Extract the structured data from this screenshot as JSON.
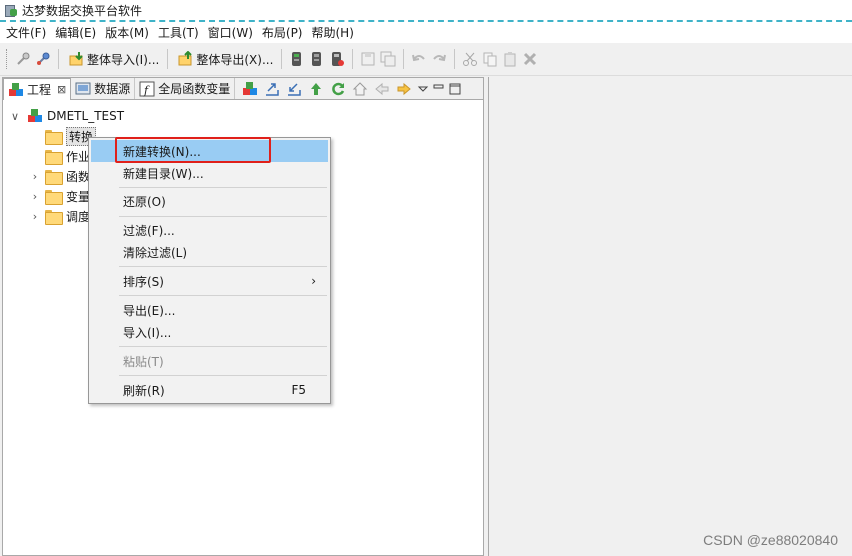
{
  "window": {
    "title": "达梦数据交换平台软件"
  },
  "menubar": {
    "items": [
      "文件(F)",
      "编辑(E)",
      "版本(M)",
      "工具(T)",
      "窗口(W)",
      "布局(P)",
      "帮助(H)"
    ]
  },
  "toolbar": {
    "import_label": "整体导入(I)...",
    "export_label": "整体导出(X)..."
  },
  "tabs": {
    "project": "工程",
    "datasource": "数据源",
    "global_vars": "全局函数变量"
  },
  "tree": {
    "root": "DMETL_TEST",
    "children": [
      "转换",
      "作业",
      "函数",
      "变量",
      "调度"
    ]
  },
  "context_menu": {
    "items": [
      {
        "label": "新建转换(N)...",
        "highlighted": true
      },
      {
        "label": "新建目录(W)..."
      },
      {
        "label": "还原(O)"
      },
      {
        "label": "过滤(F)..."
      },
      {
        "label": "清除过滤(L)"
      },
      {
        "label": "排序(S)",
        "submenu": true
      },
      {
        "label": "导出(E)..."
      },
      {
        "label": "导入(I)..."
      },
      {
        "label": "粘贴(T)",
        "disabled": true
      },
      {
        "label": "刷新(R)",
        "shortcut": "F5"
      }
    ]
  },
  "colors": {
    "highlight": "#99ccf3",
    "annotation_box": "#e0201a"
  },
  "watermark": "CSDN @ze88020840"
}
